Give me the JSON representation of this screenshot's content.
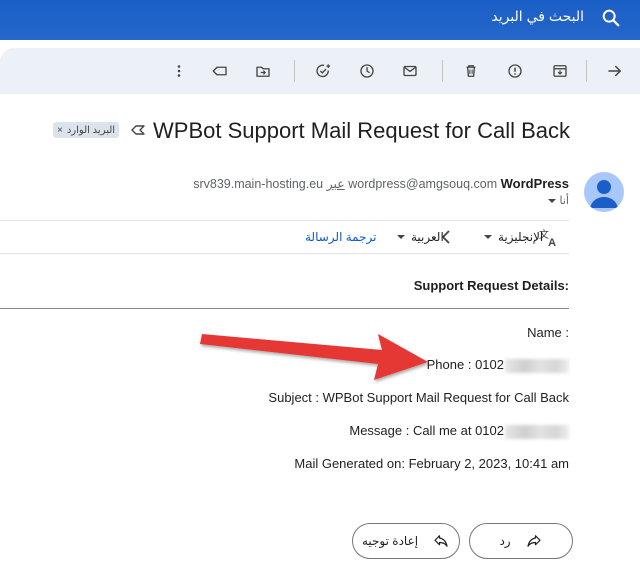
{
  "search": {
    "placeholder": "البحث في البريد"
  },
  "toolbar": {
    "icons": [
      "back-arrow-icon",
      "archive-icon",
      "report-spam-icon",
      "delete-icon",
      "mark-unread-icon",
      "snooze-icon",
      "add-to-tasks-icon",
      "move-to-icon",
      "label-icon",
      "more-vert-icon"
    ]
  },
  "email": {
    "subject": "WPBot Support Mail Request for Call Back",
    "label_chip": "البريد الوارد",
    "label_close": "×",
    "sender_name": "WordPress",
    "sender_email": "wordpress@amgsouq.com",
    "via_text": "عبر",
    "via_domain": "srv839.main-hosting.eu",
    "to_label": "أنا"
  },
  "translate": {
    "from_lang": "الإنجليزية",
    "to_lang": "العربية",
    "translate_link": "ترجمة الرسالة"
  },
  "body": {
    "details_title": "Support Request Details:",
    "name_line": "Name :",
    "phone_line": "Phone : 0102",
    "subject_line": "Subject : WPBot Support Mail Request for Call Back",
    "message_line": "Message : Call me at 0102",
    "generated_line": "Mail Generated on: February 2, 2023, 10:41 am"
  },
  "actions": {
    "reply_label": "رد",
    "forward_label": "إعادة توجيه"
  },
  "colors": {
    "topbar": "#1a5fc7",
    "toolbar_bg": "#ecf1f8",
    "link": "#0b57d0",
    "annotation_arrow": "#e53935",
    "avatar_bg": "#a8c7fa",
    "avatar_fg": "#1a5fc7"
  }
}
